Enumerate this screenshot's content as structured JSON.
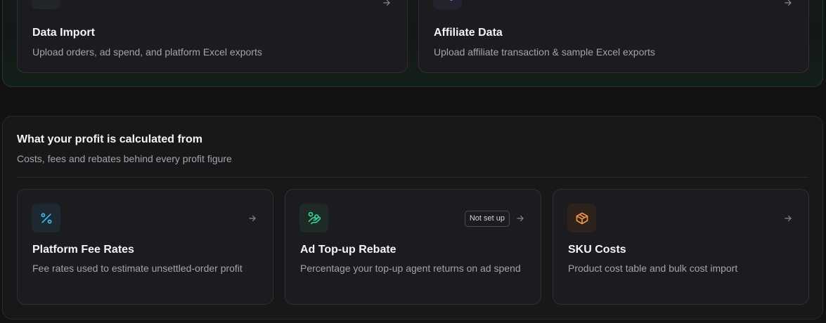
{
  "top_cards": [
    {
      "title": "Data Import",
      "description": "Upload orders, ad spend, and platform Excel exports",
      "icon": "upload-icon"
    },
    {
      "title": "Affiliate Data",
      "description": "Upload affiliate transaction & sample Excel exports",
      "icon": "share-icon"
    }
  ],
  "profit_section": {
    "title": "What your profit is calculated from",
    "subtitle": "Costs, fees and rebates behind every profit figure",
    "cards": [
      {
        "title": "Platform Fee Rates",
        "description": "Fee rates used to estimate unsettled-order profit",
        "icon": "percent-icon"
      },
      {
        "title": "Ad Top-up Rebate",
        "description": "Percentage your top-up agent returns on ad spend",
        "icon": "hand-coins-icon",
        "badge": "Not set up"
      },
      {
        "title": "SKU Costs",
        "description": "Product cost table and bulk cost import",
        "icon": "package-icon"
      }
    ]
  },
  "colors": {
    "upload": "#4ade80",
    "share": "#a78bfa",
    "percent": "#38bdf8",
    "rebate": "#34d399",
    "package": "#fb923c"
  }
}
